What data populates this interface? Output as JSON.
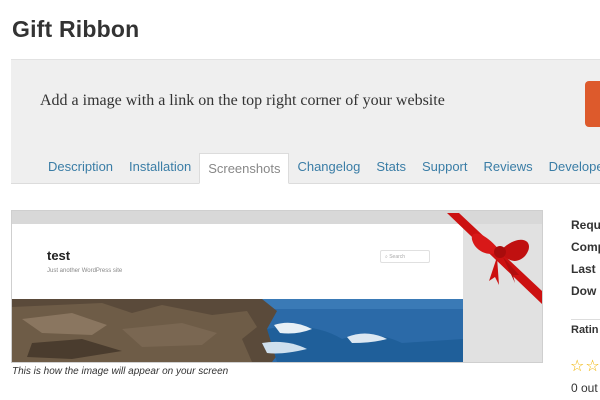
{
  "plugin": {
    "title": "Gift Ribbon",
    "description": "Add a image with a link on the top right corner of your website"
  },
  "tabs": [
    {
      "label": "Description",
      "active": false
    },
    {
      "label": "Installation",
      "active": false
    },
    {
      "label": "Screenshots",
      "active": true
    },
    {
      "label": "Changelog",
      "active": false
    },
    {
      "label": "Stats",
      "active": false
    },
    {
      "label": "Support",
      "active": false
    },
    {
      "label": "Reviews",
      "active": false
    },
    {
      "label": "Developer",
      "active": false
    }
  ],
  "colors": {
    "link": "#3a7da6",
    "accent_button": "#dd5a2c",
    "ribbon": "#cc1111"
  },
  "screenshot": {
    "site_title": "test",
    "site_tagline": "Just another WordPress site",
    "search_placeholder": "Search",
    "caption": "This is how the image will appear on your screen"
  },
  "sidebar": {
    "meta": [
      "Requ",
      "Comp",
      "Last",
      "Dow"
    ],
    "ratings_label": "Ratin",
    "ratings_stars": "☆☆",
    "ratings_count": "0 out"
  }
}
